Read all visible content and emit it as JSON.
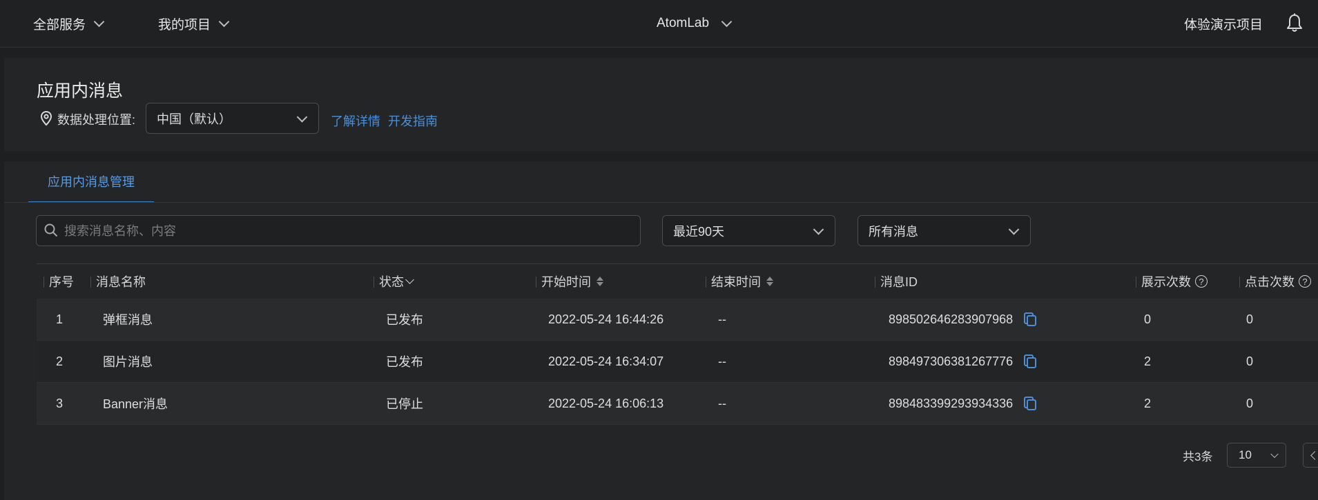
{
  "topbar": {
    "all_services": "全部服务",
    "my_projects": "我的项目",
    "app_name": "AtomLab",
    "demo_project": "体验演示项目"
  },
  "header": {
    "title": "应用内消息",
    "location_label": "数据处理位置:",
    "location_value": "中国（默认）",
    "link_details": "了解详情",
    "link_dev_guide": "开发指南"
  },
  "tabs": [
    {
      "label": "应用内消息管理",
      "active": true
    }
  ],
  "filters": {
    "search_placeholder": "搜索消息名称、内容",
    "date_range": "最近90天",
    "message_type": "所有消息"
  },
  "table": {
    "columns": {
      "index": "序号",
      "name": "消息名称",
      "status": "状态",
      "start_time": "开始时间",
      "end_time": "结束时间",
      "message_id": "消息ID",
      "impressions": "展示次数",
      "clicks": "点击次数"
    },
    "rows": [
      {
        "index": "1",
        "name": "弹框消息",
        "status": "已发布",
        "start_time": "2022-05-24 16:44:26",
        "end_time": "--",
        "message_id": "898502646283907968",
        "impressions": "0",
        "clicks": "0"
      },
      {
        "index": "2",
        "name": "图片消息",
        "status": "已发布",
        "start_time": "2022-05-24 16:34:07",
        "end_time": "--",
        "message_id": "898497306381267776",
        "impressions": "2",
        "clicks": "0"
      },
      {
        "index": "3",
        "name": "Banner消息",
        "status": "已停止",
        "start_time": "2022-05-24 16:06:13",
        "end_time": "--",
        "message_id": "898483399293934336",
        "impressions": "2",
        "clicks": "0"
      }
    ]
  },
  "pagination": {
    "total": "共3条",
    "page_size": "10"
  },
  "icons": {
    "chevron": "chevron-down-icon",
    "bell": "bell-icon",
    "location": "location-pin-icon",
    "search": "search-icon",
    "copy": "copy-icon",
    "help": "question-circle-icon"
  },
  "colors": {
    "accent": "#4c8fd6",
    "background": "#1e1f20",
    "card": "#242526"
  }
}
